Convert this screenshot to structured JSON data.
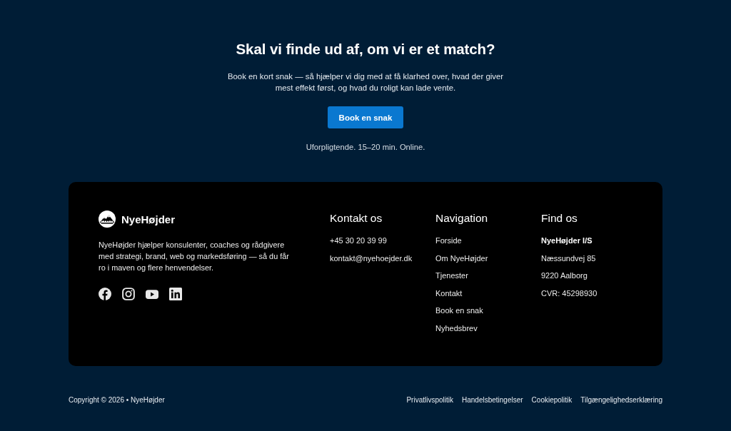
{
  "cta": {
    "heading": "Skal vi finde ud af, om vi er et match?",
    "text": "Book en kort snak — så hjælper vi dig med at få klarhed over, hvad der giver mest effekt først, og hvad du roligt kan lade vente.",
    "button": "Book en snak",
    "note": "Uforpligtende. 15–20 min. Online."
  },
  "footer": {
    "brand": {
      "name": "NyeHøjder"
    },
    "description": "NyeHøjder hjælper konsulenter, coaches og rådgivere med strategi, brand, web og markedsføring — så du får ro i maven og flere henvendelser.",
    "social_links": [
      {
        "kind": "facebook"
      },
      {
        "kind": "instagram"
      },
      {
        "kind": "youtube"
      },
      {
        "kind": "linkedin"
      }
    ],
    "contact": {
      "heading": "Kontakt os",
      "phone": "+45 30 20 39 99",
      "email": "kontakt@nyehoejder.dk"
    },
    "navigation": {
      "heading": "Navigation",
      "links": [
        "Forside",
        "Om NyeHøjder",
        "Tjenester",
        "Kontakt",
        "Book en snak",
        "Nyhedsbrev"
      ]
    },
    "find_us": {
      "heading": "Find os",
      "company": "NyeHøjder I/S",
      "address": [
        "Næssundvej 85",
        "9220 Aalborg",
        "CVR: 45298930"
      ]
    }
  },
  "bottom_bar": {
    "copyright": "Copyright © 2026 • NyeHøjder",
    "links": [
      "Privatlivspolitik",
      "Handelsbetingelser",
      "Cookiepolitik",
      "Tilgængelighedserklæring"
    ]
  }
}
